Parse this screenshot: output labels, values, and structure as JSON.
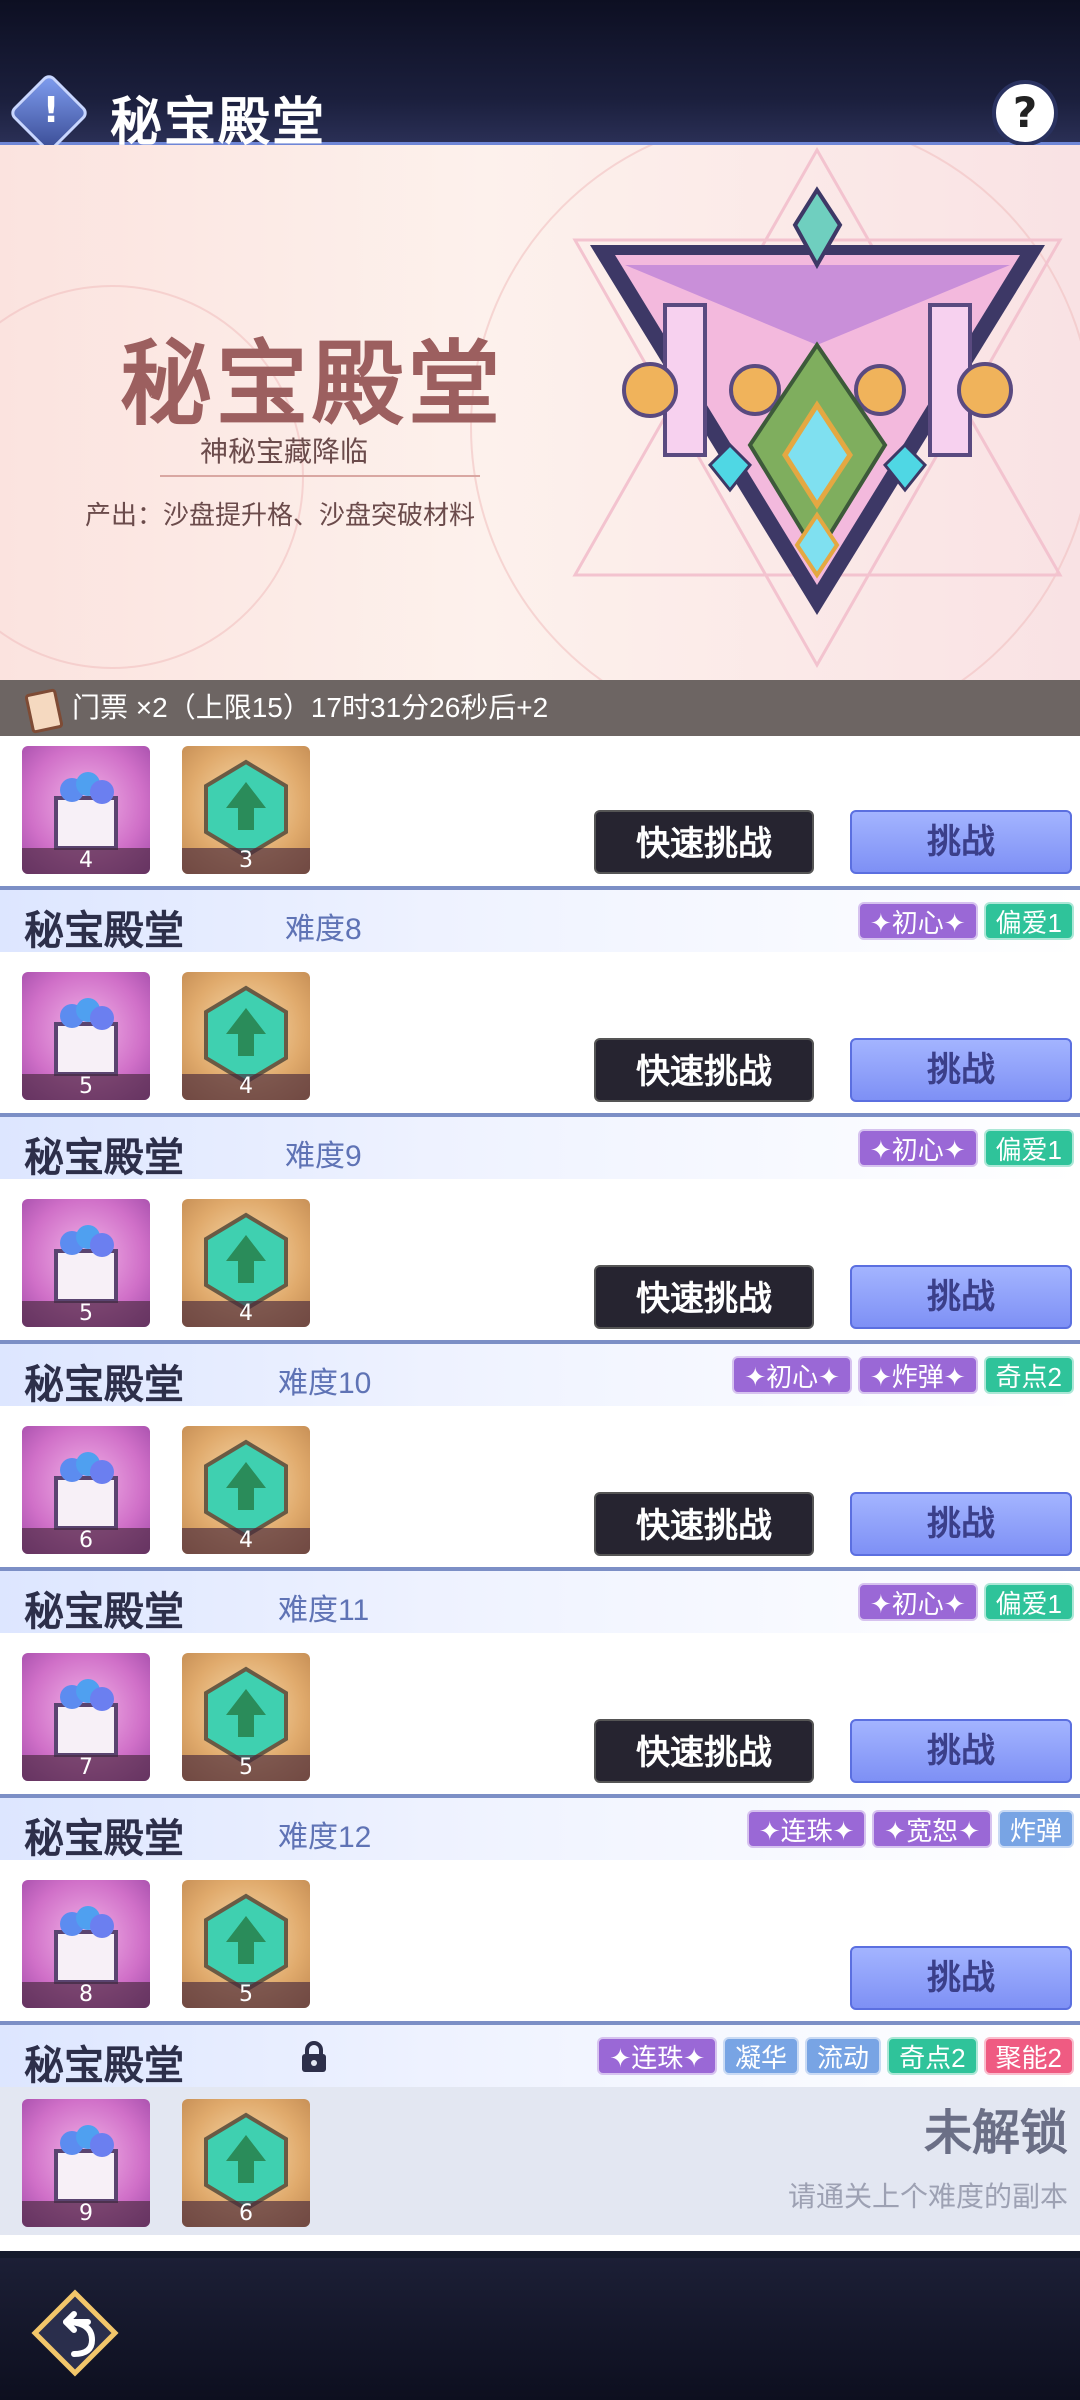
{
  "header": {
    "title": "秘宝殿堂",
    "info_icon": "!",
    "help_icon": "?"
  },
  "banner": {
    "title": "秘宝殿堂",
    "subtitle": "神秘宝藏降临",
    "output": "产出：沙盘提升格、沙盘突破材料"
  },
  "ticket": {
    "text": "门票 ×2（上限15）17时31分26秒后+2"
  },
  "buttons": {
    "quick": "快速挑战",
    "fight": "挑战"
  },
  "levels": [
    {
      "name": "",
      "difficulty": "",
      "tags": [],
      "rewards": [
        "4",
        "3"
      ]
    },
    {
      "name": "秘宝殿堂",
      "difficulty": "难度8",
      "tags": [
        {
          "label": "✦初心✦",
          "color": "purple"
        },
        {
          "label": "偏爱1",
          "color": "green"
        }
      ],
      "rewards": [
        "5",
        "4"
      ]
    },
    {
      "name": "秘宝殿堂",
      "difficulty": "难度9",
      "tags": [
        {
          "label": "✦初心✦",
          "color": "purple"
        },
        {
          "label": "偏爱1",
          "color": "green"
        }
      ],
      "rewards": [
        "5",
        "4"
      ]
    },
    {
      "name": "秘宝殿堂",
      "difficulty": "难度10",
      "tags": [
        {
          "label": "✦初心✦",
          "color": "purple"
        },
        {
          "label": "✦炸弹✦",
          "color": "purple"
        },
        {
          "label": "奇点2",
          "color": "green"
        }
      ],
      "rewards": [
        "6",
        "4"
      ]
    },
    {
      "name": "秘宝殿堂",
      "difficulty": "难度11",
      "tags": [
        {
          "label": "✦初心✦",
          "color": "purple"
        },
        {
          "label": "偏爱1",
          "color": "green"
        }
      ],
      "rewards": [
        "7",
        "5"
      ]
    },
    {
      "name": "秘宝殿堂",
      "difficulty": "难度12",
      "tags": [
        {
          "label": "✦连珠✦",
          "color": "purple"
        },
        {
          "label": "✦宽恕✦",
          "color": "purple"
        },
        {
          "label": "炸弹",
          "color": "blue"
        }
      ],
      "rewards": [
        "8",
        "5"
      ]
    },
    {
      "name": "秘宝殿堂",
      "difficulty": "",
      "tags": [
        {
          "label": "✦连珠✦",
          "color": "purple"
        },
        {
          "label": "凝华",
          "color": "blue"
        },
        {
          "label": "流动",
          "color": "blue"
        },
        {
          "label": "奇点2",
          "color": "green"
        },
        {
          "label": "聚能2",
          "color": "red"
        }
      ],
      "rewards": [
        "9",
        "6"
      ]
    }
  ],
  "locked": {
    "title": "未解锁",
    "hint": "请通关上个难度的副本"
  },
  "icons": {
    "info": "info-icon",
    "help": "help-icon",
    "ticket": "ticket-icon",
    "gem_box": "gem-box-icon",
    "upgrade": "upgrade-gem-icon",
    "lock": "lock-icon",
    "back": "back-arrow-icon"
  },
  "colors": {
    "accent": "#7e90f5",
    "tag_purple": "#9a68d6",
    "tag_green": "#2fc39a",
    "tag_blue": "#78a4e4",
    "tag_red": "#ef5b82"
  }
}
